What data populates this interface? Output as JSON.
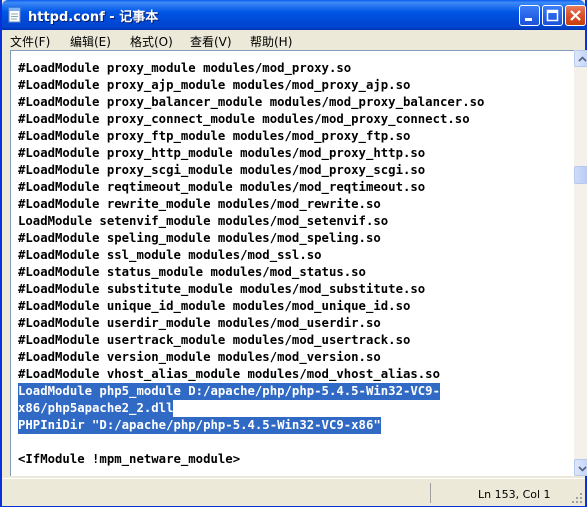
{
  "window": {
    "title": "httpd.conf - 记事本",
    "icon": "notepad-icon"
  },
  "menu": [
    {
      "label": "文件(F)"
    },
    {
      "label": "编辑(E)"
    },
    {
      "label": "格式(O)"
    },
    {
      "label": "查看(V)"
    },
    {
      "label": "帮助(H)"
    }
  ],
  "lines": [
    {
      "text": "#LoadModule proxy_module modules/mod_proxy.so",
      "selected": false
    },
    {
      "text": "#LoadModule proxy_ajp_module modules/mod_proxy_ajp.so",
      "selected": false
    },
    {
      "text": "#LoadModule proxy_balancer_module modules/mod_proxy_balancer.so",
      "selected": false
    },
    {
      "text": "#LoadModule proxy_connect_module modules/mod_proxy_connect.so",
      "selected": false
    },
    {
      "text": "#LoadModule proxy_ftp_module modules/mod_proxy_ftp.so",
      "selected": false
    },
    {
      "text": "#LoadModule proxy_http_module modules/mod_proxy_http.so",
      "selected": false
    },
    {
      "text": "#LoadModule proxy_scgi_module modules/mod_proxy_scgi.so",
      "selected": false
    },
    {
      "text": "#LoadModule reqtimeout_module modules/mod_reqtimeout.so",
      "selected": false
    },
    {
      "text": "#LoadModule rewrite_module modules/mod_rewrite.so",
      "selected": false
    },
    {
      "text": "LoadModule setenvif_module modules/mod_setenvif.so",
      "selected": false
    },
    {
      "text": "#LoadModule speling_module modules/mod_speling.so",
      "selected": false
    },
    {
      "text": "#LoadModule ssl_module modules/mod_ssl.so",
      "selected": false
    },
    {
      "text": "#LoadModule status_module modules/mod_status.so",
      "selected": false
    },
    {
      "text": "#LoadModule substitute_module modules/mod_substitute.so",
      "selected": false
    },
    {
      "text": "#LoadModule unique_id_module modules/mod_unique_id.so",
      "selected": false
    },
    {
      "text": "#LoadModule userdir_module modules/mod_userdir.so",
      "selected": false
    },
    {
      "text": "#LoadModule usertrack_module modules/mod_usertrack.so",
      "selected": false
    },
    {
      "text": "#LoadModule version_module modules/mod_version.so",
      "selected": false
    },
    {
      "text": "#LoadModule vhost_alias_module modules/mod_vhost_alias.so",
      "selected": false
    },
    {
      "text": "LoadModule php5_module D:/apache/php/php-5.4.5-Win32-VC9-",
      "selected": true
    },
    {
      "text": "x86/php5apache2_2.dll",
      "selected": true
    },
    {
      "text": "PHPIniDir \"D:/apache/php/php-5.4.5-Win32-VC9-x86\"",
      "selected": true
    },
    {
      "text": "",
      "selected": false
    },
    {
      "text": "<IfModule !mpm_netware_module>",
      "selected": false
    }
  ],
  "status": {
    "position": "Ln 153, Col 1"
  },
  "colors": {
    "titlebar": "#0055e5",
    "selection": "#316ac5",
    "chrome": "#ece9d8"
  }
}
